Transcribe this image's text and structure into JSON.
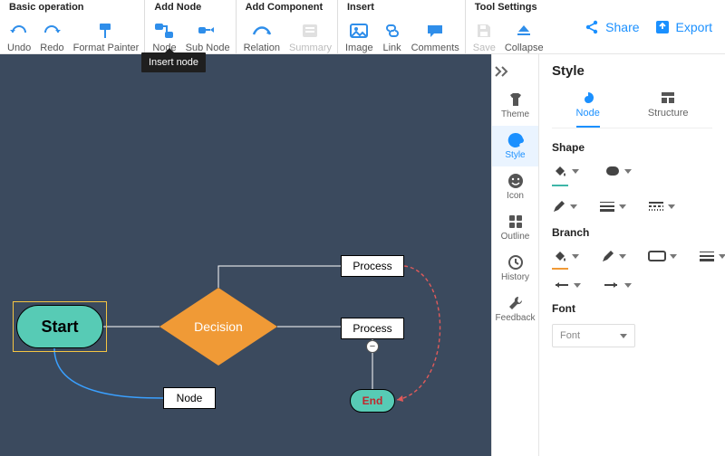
{
  "toolbar": {
    "groups": {
      "basic": {
        "title": "Basic operation",
        "undo": "Undo",
        "redo": "Redo",
        "format_painter": "Format Painter"
      },
      "addnode": {
        "title": "Add Node",
        "node": "Node",
        "sub_node": "Sub Node"
      },
      "addcomp": {
        "title": "Add Component",
        "relation": "Relation",
        "summary": "Summary"
      },
      "insert": {
        "title": "Insert",
        "image": "Image",
        "link": "Link",
        "comments": "Comments"
      },
      "toolset": {
        "title": "Tool Settings",
        "save": "Save",
        "collapse": "Collapse"
      }
    },
    "share": "Share",
    "export": "Export",
    "tooltip": "Insert node"
  },
  "sidebar": {
    "items": [
      {
        "id": "theme",
        "label": "Theme"
      },
      {
        "id": "style",
        "label": "Style"
      },
      {
        "id": "icon",
        "label": "Icon"
      },
      {
        "id": "outline",
        "label": "Outline"
      },
      {
        "id": "history",
        "label": "History"
      },
      {
        "id": "feedback",
        "label": "Feedback"
      }
    ]
  },
  "panel": {
    "title": "Style",
    "tabs": {
      "node": "Node",
      "structure": "Structure"
    },
    "sections": {
      "shape": "Shape",
      "branch": "Branch",
      "font": "Font"
    },
    "font_select": "Font"
  },
  "canvas": {
    "start": "Start",
    "decision": "Decision",
    "process1": "Process",
    "process2": "Process",
    "free_node": "Node",
    "end": "End",
    "collapse_badge": "−"
  }
}
